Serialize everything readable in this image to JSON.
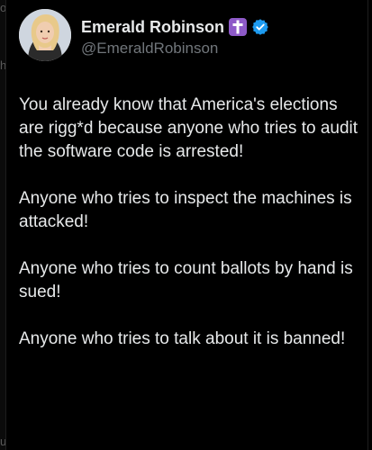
{
  "left_edge": {
    "glyphs": [
      "ou",
      "h",
      "ul"
    ]
  },
  "tweet": {
    "author": {
      "display_name": "Emerald Robinson",
      "emoji_badge": "latin-cross-emoji",
      "verified_badge": "verified-check-icon",
      "handle": "@EmeraldRobinson"
    },
    "paragraphs": [
      "You already know that America's elections are rigg*d because anyone who tries to audit the software code is arrested!",
      "Anyone who tries to inspect the machines is attacked!",
      "Anyone who tries to count ballots by hand is sued!",
      "Anyone who tries to talk about it is banned!"
    ]
  },
  "colors": {
    "background": "#000000",
    "text": "#e7e9ea",
    "secondary_text": "#71767b",
    "verified_blue": "#1d9bf0",
    "emoji_purple": "#8e5ac8"
  }
}
